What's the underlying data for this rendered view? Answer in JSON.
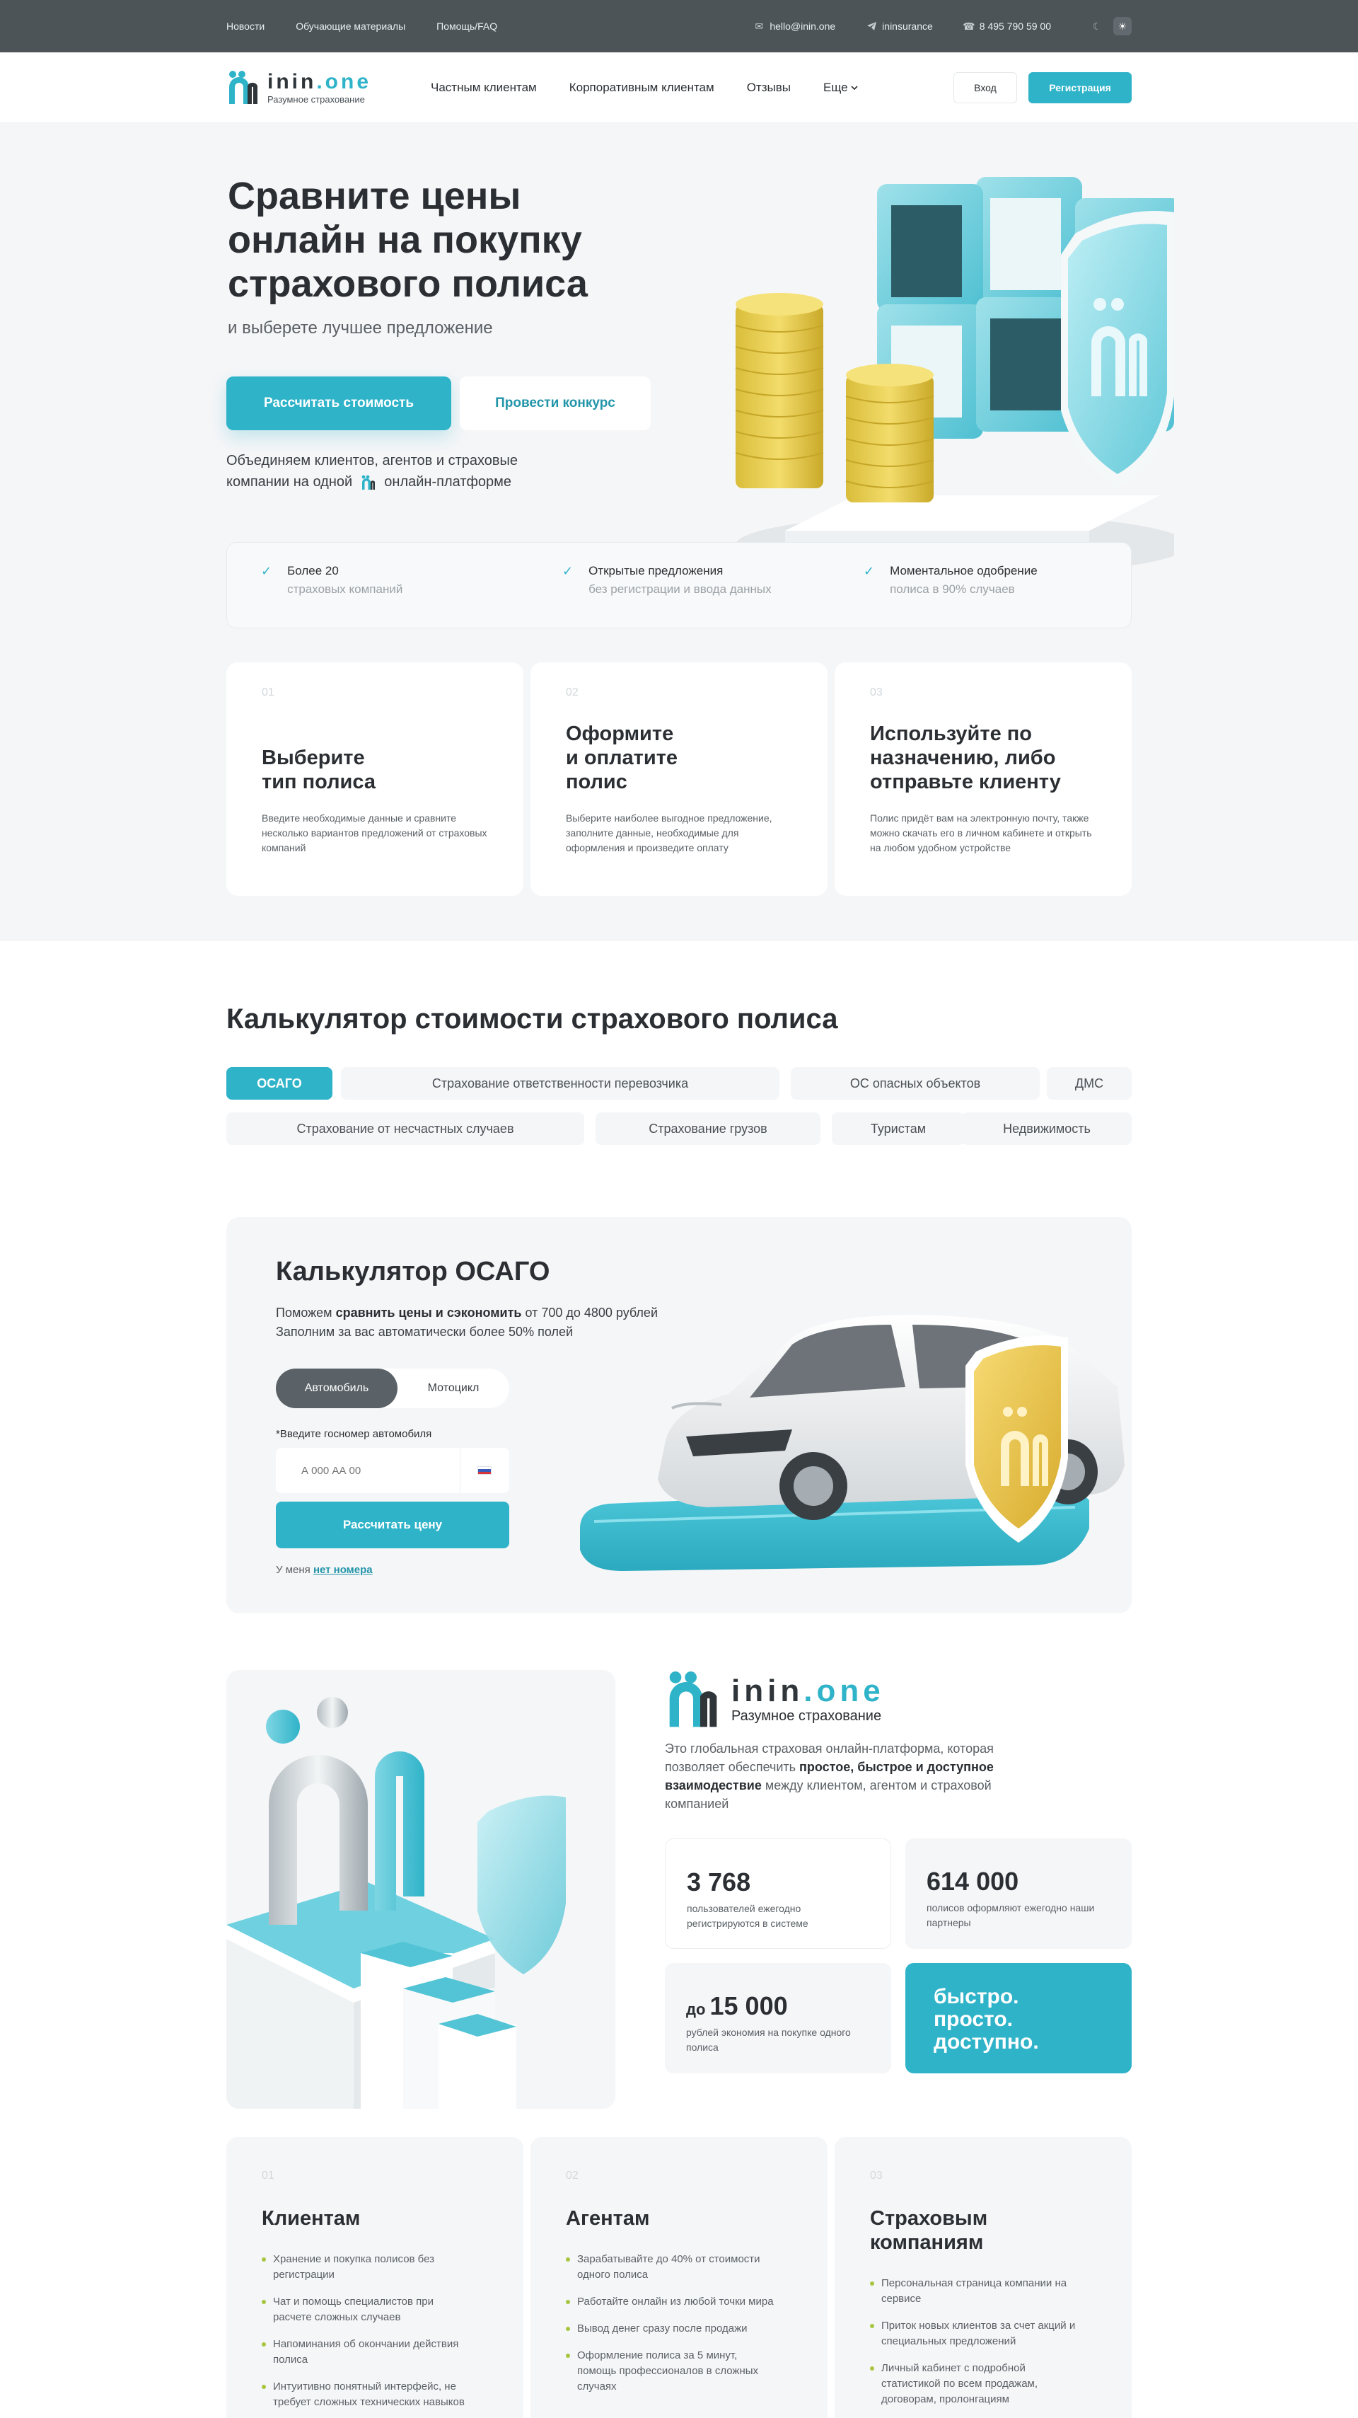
{
  "topbar": {
    "links": [
      "Новости",
      "Обучающие материалы",
      "Помощь/FAQ"
    ],
    "email": "hello@inin.one",
    "telegram": "ininsurance",
    "phone": "8 495 790 59 00"
  },
  "brand": {
    "name_main": "inin",
    "name_dot": ".",
    "name_suffix": "one",
    "tagline": "Разумное страхование",
    "accent": "#2fb3c9"
  },
  "nav": {
    "items": [
      "Частным клиентам",
      "Корпоративным клиентам",
      "Отзывы",
      "Еще"
    ],
    "login": "Вход",
    "register": "Регистрация"
  },
  "hero": {
    "title_l1": "Сравните цены",
    "title_l2_bold": "онлайн",
    "title_l2_rest": " на покупку",
    "title_l3": "страхового полиса",
    "subtitle": "и выберете лучшее предложение",
    "btn_calc": "Рассчитать стоимость",
    "btn_contest": "Провести конкурс",
    "join_l1": "Объединяем клиентов, агентов и страховые",
    "join_l2a": "компании на одной",
    "join_l2b": "онлайн-платформе"
  },
  "features": [
    {
      "title": "Более 20",
      "sub": "страховых компаний"
    },
    {
      "title": "Открытые предложения",
      "sub": "без регистрации и ввода данных"
    },
    {
      "title": "Моментальное одобрение",
      "sub": "полиса в 90% случаев"
    }
  ],
  "steps": [
    {
      "num": "01",
      "title_l1": "Выберите",
      "title_l2": "тип полиса",
      "title_l3": "",
      "text": "Введите необходимые данные и сравните несколько вариантов предложений от страховых компаний"
    },
    {
      "num": "02",
      "title_l1": "Оформите",
      "title_l2": "и оплатите",
      "title_l3": "полис",
      "text": "Выберите наиболее выгодное предложение, заполните данные, необходимые для оформления и произведите оплату"
    },
    {
      "num": "03",
      "title_l1": "Используйте по",
      "title_l2": "назначению, либо",
      "title_l3": "отправьте клиенту",
      "text": "Полис придёт вам на электронную почту, также можно скачать его в личном кабинете и открыть на любом удобном устройстве"
    }
  ],
  "calculator": {
    "title": "Калькулятор стоимости страхового полиса",
    "tabs": [
      "ОСАГО",
      "Страхование ответственности перевозчика",
      "ОС опасных объектов",
      "ДМС",
      "Страхование от несчастных случаев",
      "Страхование грузов",
      "Туристам",
      "Недвижимость"
    ],
    "card_title": "Калькулятор ОСАГО",
    "desc_a": "Поможем ",
    "desc_bold": "сравнить цены и сэкономить",
    "desc_b": " от 700 до 4800 рублей Заполним за вас автоматически более 50% полей",
    "seg_car": "Автомобиль",
    "seg_moto": "Мотоцикл",
    "plate_label": "*Введите госномер автомобиля",
    "plate_placeholder": "А 000 АА 00",
    "btn_price": "Рассчитать цену",
    "no_number_a": "У меня ",
    "no_number_link": "нет номера"
  },
  "about": {
    "desc_a": "Это глобальная страховая онлайн-платформа, которая позволяет обеспечить ",
    "desc_bold": "простое, быстрое и доступное взаимодествие",
    "desc_b": " между клиентом, агентом и страховой компанией",
    "stats": [
      {
        "prefix": "",
        "value": "3 768",
        "text": "пользователей ежегодно регистрируются в системе"
      },
      {
        "prefix": "",
        "value": "614 000",
        "text": "полисов оформляют ежегодно наши партнеры"
      },
      {
        "prefix": "до ",
        "value": "15 000",
        "text": "рублей экономия на покупке одного полиса"
      }
    ],
    "slogan": [
      "быстро.",
      "просто.",
      "доступно."
    ]
  },
  "audiences": [
    {
      "num": "01",
      "title_l1": "Клиентам",
      "title_l2": "",
      "items": [
        "Хранение и покупка полисов без регистрации",
        "Чат и помощь специалистов при расчете сложных случаев",
        "Напоминания об окончании действия полиса",
        "Интуитивно понятный интерфейс, не требует сложных технических навыков"
      ]
    },
    {
      "num": "02",
      "title_l1": "Агентам",
      "title_l2": "",
      "items": [
        "Зарабатывайте до 40% от стоимости одного полиса",
        "Работайте онлайн из любой точки мира",
        "Вывод денег сразу после продажи",
        "Оформление полиса за 5 минут, помощь профессионалов в сложных случаях"
      ]
    },
    {
      "num": "03",
      "title_l1": "Страховым",
      "title_l2": "компаниям",
      "items": [
        "Персональная страница компании на сервисе",
        "Приток новых клиентов за счет акций и специальных предложений",
        "Личный кабинет с подробной статистикой по всем продажам, договорам, пролонгациям"
      ]
    }
  ]
}
